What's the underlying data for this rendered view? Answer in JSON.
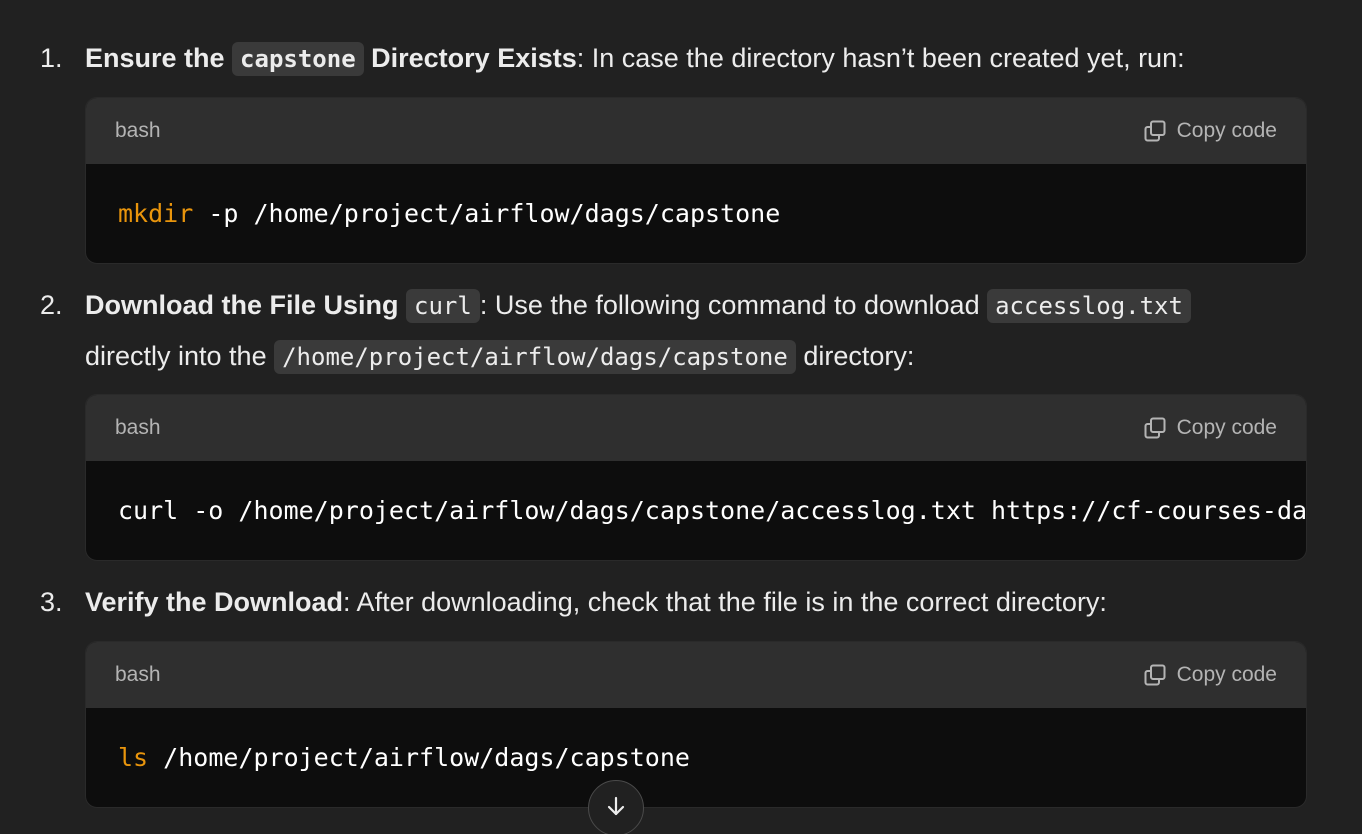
{
  "steps": [
    {
      "number": "1.",
      "bold_before": "Ensure the ",
      "inline_code": "capstone",
      "bold_after": " Directory Exists",
      "text": ": In case the directory hasn’t been created yet, run:",
      "code_lang": "bash",
      "copy_label": "Copy code",
      "code_cmd": "mkdir",
      "code_rest": " -p /home/project/airflow/dags/capstone"
    },
    {
      "number": "2.",
      "bold": "Download the File Using ",
      "inline_code_1": "curl",
      "text_1": ": Use the following command to download ",
      "inline_code_2": "accesslog.txt",
      "text_2": "directly into the ",
      "inline_code_3": "/home/project/airflow/dags/capstone",
      "text_3": " directory:",
      "code_lang": "bash",
      "copy_label": "Copy code",
      "code_line": "curl -o /home/project/airflow/dags/capstone/accesslog.txt https://cf-courses-da"
    },
    {
      "number": "3.",
      "bold": "Verify the Download",
      "text": ": After downloading, check that the file is in the correct directory:",
      "code_lang": "bash",
      "copy_label": "Copy code",
      "code_cmd": "ls",
      "code_rest": " /home/project/airflow/dags/capstone"
    }
  ],
  "icons": {
    "copy": "copy-icon",
    "scroll": "arrow-down-icon"
  },
  "colors": {
    "background": "#212121",
    "code_header": "#2f2f2f",
    "code_body": "#0d0d0d",
    "keyword": "#e9950c"
  }
}
